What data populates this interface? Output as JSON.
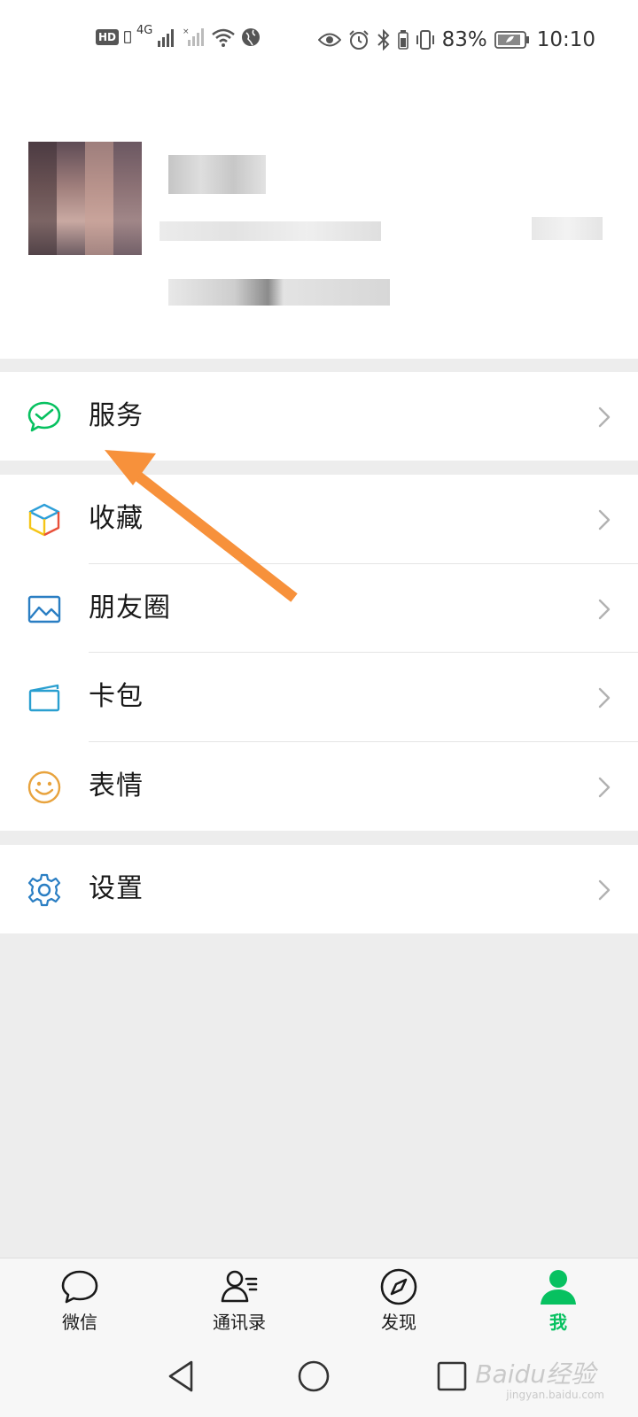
{
  "status_bar": {
    "hd_badge": "HD",
    "network": "4G",
    "battery_percent": "83%",
    "time": "10:10"
  },
  "menu": {
    "service": "服务",
    "favorites": "收藏",
    "moments": "朋友圈",
    "cards": "卡包",
    "stickers": "表情",
    "settings": "设置"
  },
  "tab_bar": {
    "active": "我",
    "tabs": [
      {
        "label": "微信",
        "icon": "chat-bubble-icon"
      },
      {
        "label": "通讯录",
        "icon": "contacts-icon"
      },
      {
        "label": "发现",
        "icon": "compass-icon"
      },
      {
        "label": "我",
        "icon": "person-icon"
      }
    ]
  },
  "watermark": {
    "text": "Baidu经验",
    "sub": "jingyan.baidu.com"
  },
  "colors": {
    "accent": "#07c160",
    "arrow": "#f7913b",
    "background": "#ededed"
  }
}
